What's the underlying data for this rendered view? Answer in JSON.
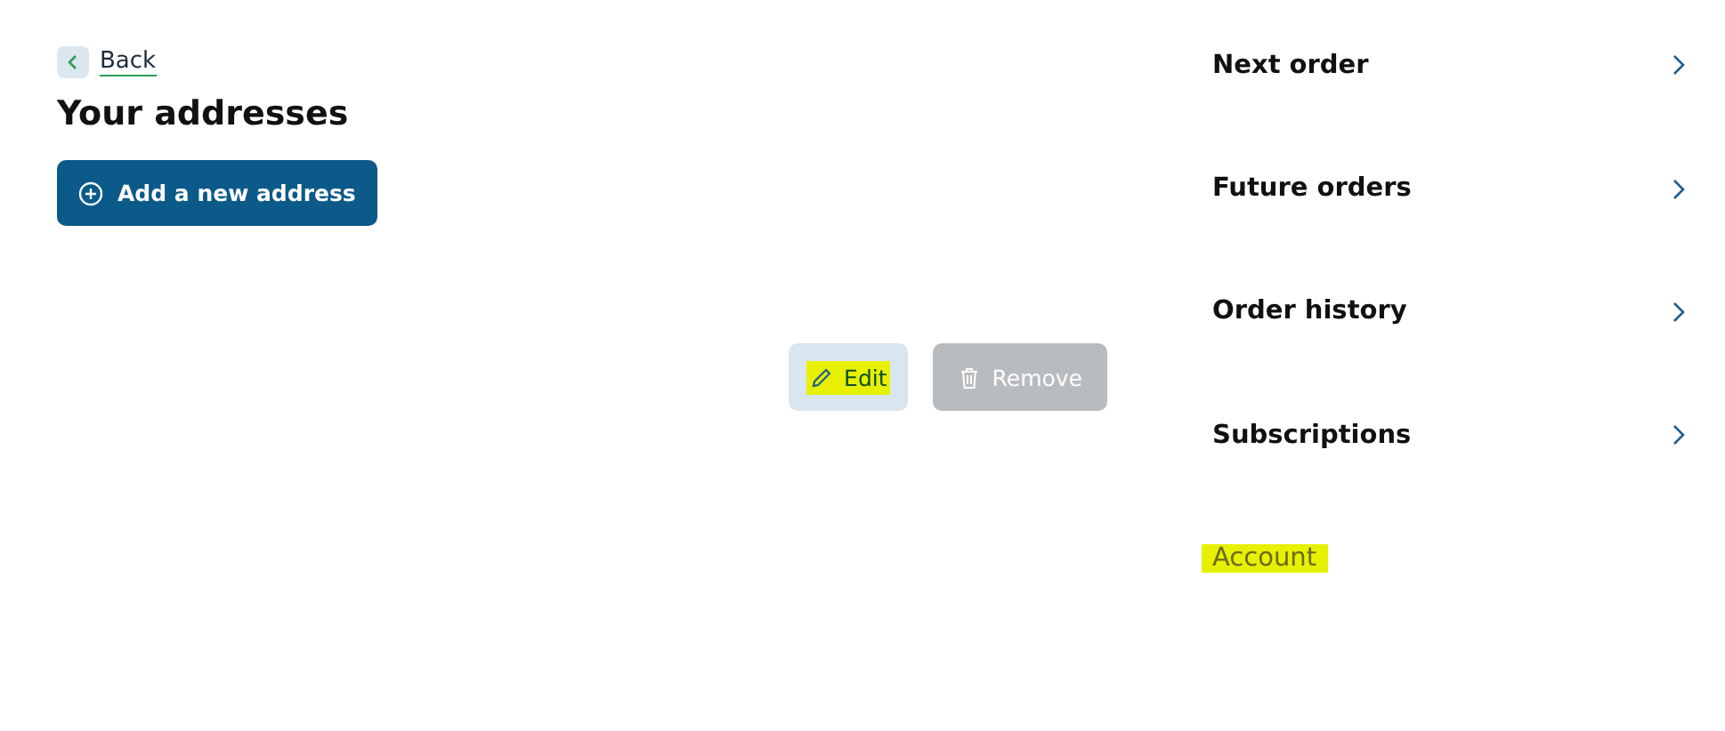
{
  "back_link": {
    "label": "Back"
  },
  "title": "Your addresses",
  "add_button": {
    "label": "Add a new address"
  },
  "address_actions": [
    {
      "kind": "edit",
      "label": "Edit",
      "highlighted": true,
      "disabled": false
    },
    {
      "kind": "remove",
      "label": "Remove",
      "highlighted": false,
      "disabled": true
    }
  ],
  "nav": {
    "items": [
      {
        "label": "Next order",
        "selected": false
      },
      {
        "label": "Future orders",
        "selected": false
      },
      {
        "label": "Order history",
        "selected": false
      },
      {
        "label": "Subscriptions",
        "selected": false
      },
      {
        "label": "Account",
        "selected": true
      }
    ]
  }
}
